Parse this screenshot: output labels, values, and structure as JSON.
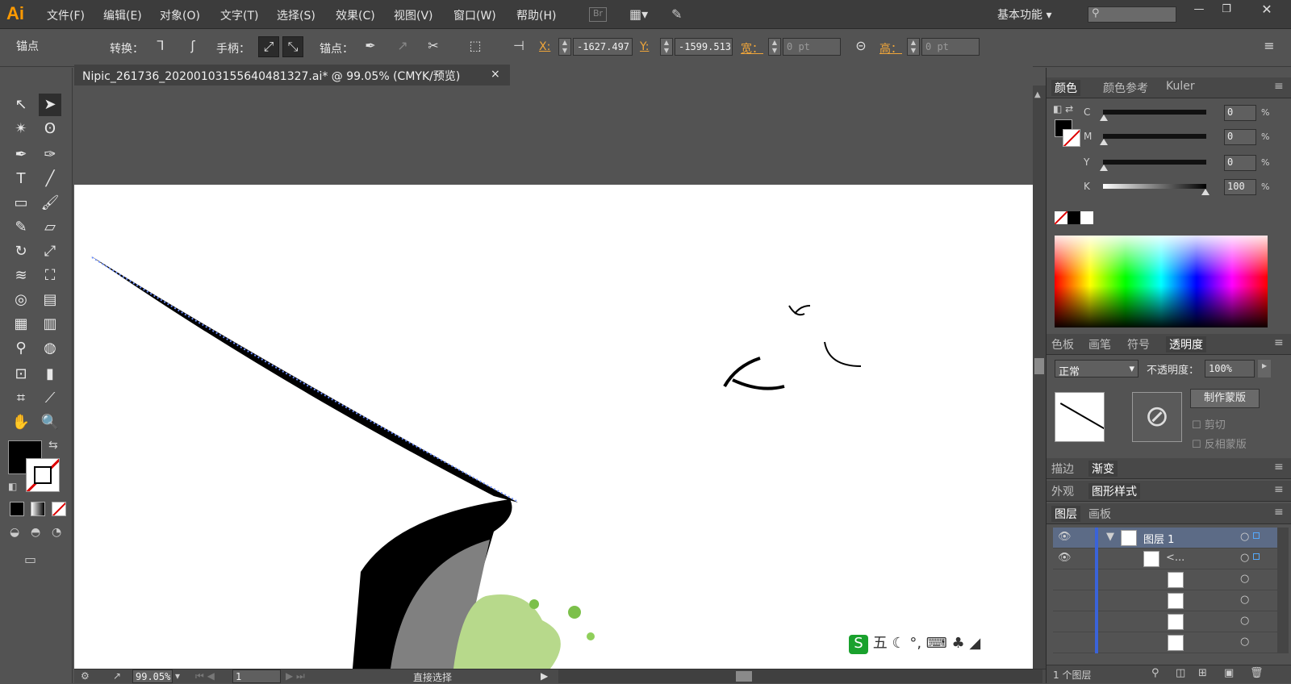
{
  "app": {
    "logo": "Ai",
    "workspace": "基本功能",
    "bridge": "Br",
    "search_placeholder": ""
  },
  "menu": [
    "文件(F)",
    "编辑(E)",
    "对象(O)",
    "文字(T)",
    "选择(S)",
    "效果(C)",
    "视图(V)",
    "窗口(W)",
    "帮助(H)"
  ],
  "control": {
    "tool_name": "锚点",
    "convert_label": "转换：",
    "handle_label": "手柄：",
    "anchor_label": "锚点：",
    "x_label": "X:",
    "x_value": "-1627.497",
    "y_label": "Y:",
    "y_value": "-1599.513",
    "w_label": "宽：",
    "w_value": "0 pt",
    "h_label": "高：",
    "h_value": "0 pt"
  },
  "document": {
    "tab_title": "Nipic_261736_20200103155640481327.ai* @ 99.05% (CMYK/预览)",
    "close": "×"
  },
  "status": {
    "zoom": "99.05%",
    "page": "1",
    "tool": "直接选择"
  },
  "color_panel": {
    "tabs": [
      "颜色",
      "颜色参考",
      "Kuler"
    ],
    "channels": [
      {
        "label": "C",
        "value": "0"
      },
      {
        "label": "M",
        "value": "0"
      },
      {
        "label": "Y",
        "value": "0"
      },
      {
        "label": "K",
        "value": "100"
      }
    ],
    "unit": "%"
  },
  "transparency_panel": {
    "tabs": [
      "色板",
      "画笔",
      "符号",
      "透明度"
    ],
    "mode": "正常",
    "opacity_label": "不透明度：",
    "opacity_value": "100%",
    "make_mask": "制作蒙版",
    "clip": "剪切",
    "invert": "反相蒙版"
  },
  "stroke_panel": {
    "tabs": [
      "描边",
      "渐变"
    ]
  },
  "appearance_panel": {
    "tabs": [
      "外观",
      "图形样式"
    ]
  },
  "layers_panel": {
    "tabs": [
      "图层",
      "画板"
    ],
    "layer_name": "图层 1",
    "sublayer_name": "<...",
    "footer": "1 个图层"
  },
  "ime": {
    "label": "五"
  }
}
